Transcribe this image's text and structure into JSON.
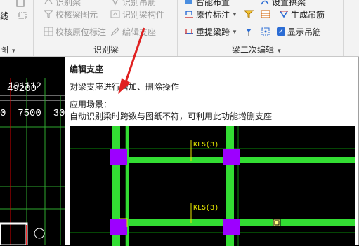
{
  "ribbon": {
    "row1": {
      "identify_beam": "识别梁",
      "identify_hanger": "识别吊筋",
      "smart_layout": "智能布置",
      "set_arch": "设置拱梁"
    },
    "check_beam_element": "校核梁图元",
    "identify_beam_component": "识别梁构件",
    "check_original_marks": "校核原位标注",
    "edit_support": "编辑支座",
    "original_mark": "原位标注",
    "generate_hanger": "生成吊筋",
    "re_extract_span": "重提梁跨",
    "show_hanger": "显示吊筋",
    "partial_line": "线",
    "partial_tu": "图",
    "group_identify_beam": "识别梁",
    "group_beam_edit": "梁二次编辑"
  },
  "cad": {
    "label_top": "101112",
    "label_num": "49200",
    "label_dims": "0  7500  30"
  },
  "tooltip": {
    "title": "编辑支座",
    "description": "对梁支座进行增加、删除操作",
    "scene_label": "应用场景：",
    "scene_text": "自动识别梁时跨数与图纸不符，可利用此功能增删支座",
    "kl_label_1": "KL5(3)",
    "kl_label_2": "KL5(3)"
  },
  "colors": {
    "beam": "#33dd33",
    "column": "#9d00ff",
    "grid_red": "#d40000",
    "grid_green": "#0a8a0a",
    "arrow": "#e02020",
    "checkbox": "#2b6cd4"
  }
}
